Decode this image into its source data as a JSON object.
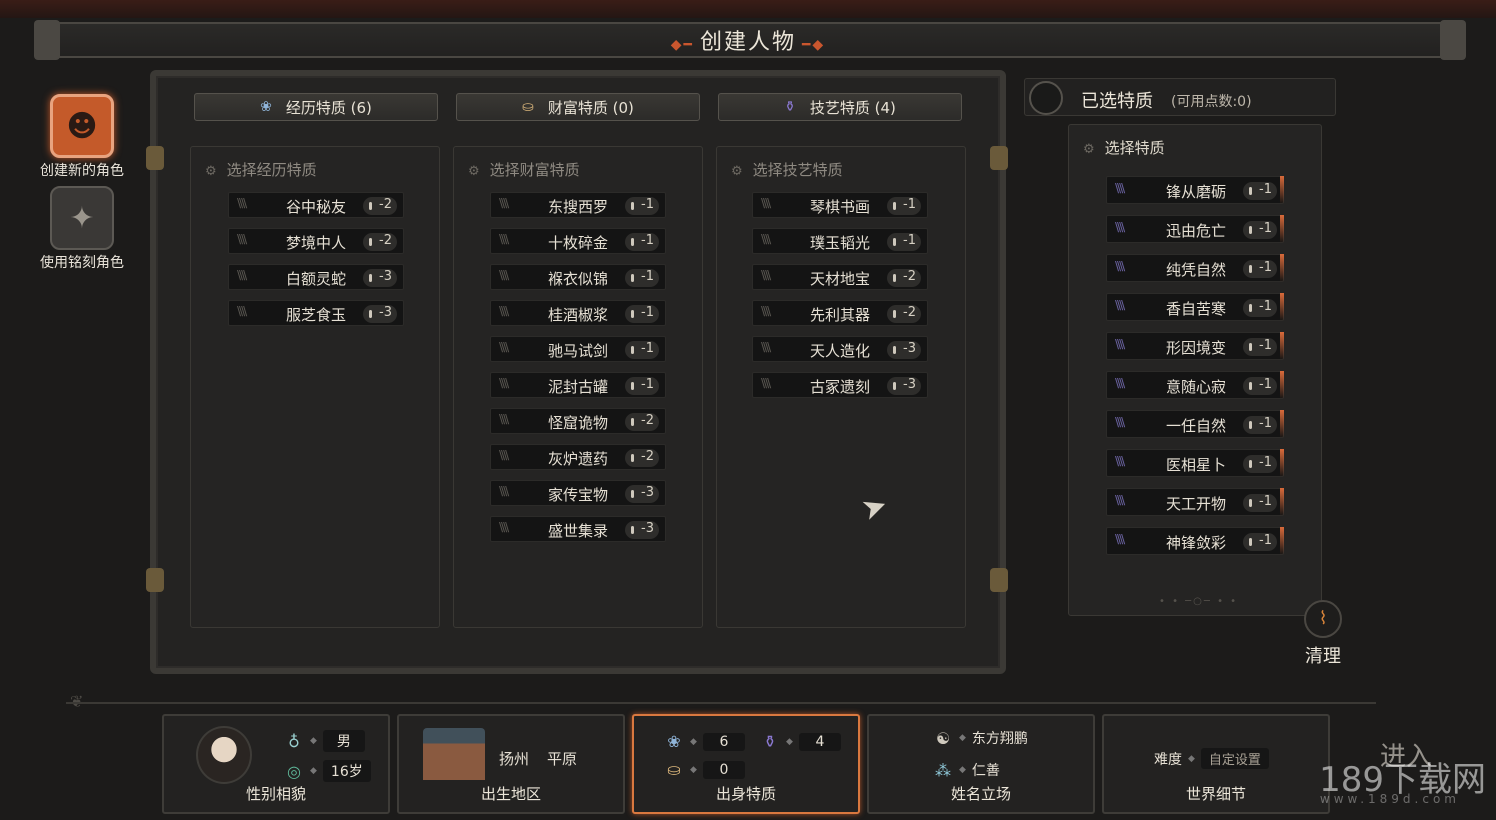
{
  "title": "创建人物",
  "side": {
    "create_new": "创建新的角色",
    "use_engraved": "使用铭刻角色"
  },
  "tabs": [
    {
      "label": "经历特质 (6)",
      "icon": "lotus-icon"
    },
    {
      "label": "财富特质 (0)",
      "icon": "ingot-icon"
    },
    {
      "label": "技艺特质 (4)",
      "icon": "vase-icon"
    }
  ],
  "columns": {
    "experience": {
      "header": "选择经历特质",
      "items": [
        {
          "name": "谷中秘友",
          "cost": "-2"
        },
        {
          "name": "梦境中人",
          "cost": "-2"
        },
        {
          "name": "白额灵蛇",
          "cost": "-3"
        },
        {
          "name": "服芝食玉",
          "cost": "-3"
        }
      ]
    },
    "wealth": {
      "header": "选择财富特质",
      "items": [
        {
          "name": "东搜西罗",
          "cost": "-1"
        },
        {
          "name": "十枚碎金",
          "cost": "-1"
        },
        {
          "name": "褓衣似锦",
          "cost": "-1"
        },
        {
          "name": "桂酒椒浆",
          "cost": "-1"
        },
        {
          "name": "驰马试剑",
          "cost": "-1"
        },
        {
          "name": "泥封古罐",
          "cost": "-1"
        },
        {
          "name": "怪窟诡物",
          "cost": "-2"
        },
        {
          "name": "灰炉遗药",
          "cost": "-2"
        },
        {
          "name": "家传宝物",
          "cost": "-3"
        },
        {
          "name": "盛世集录",
          "cost": "-3"
        }
      ]
    },
    "skill": {
      "header": "选择技艺特质",
      "items": [
        {
          "name": "琴棋书画",
          "cost": "-1"
        },
        {
          "name": "璞玉韬光",
          "cost": "-1"
        },
        {
          "name": "天材地宝",
          "cost": "-2"
        },
        {
          "name": "先利其器",
          "cost": "-2"
        },
        {
          "name": "天人造化",
          "cost": "-3"
        },
        {
          "name": "古冢遗刻",
          "cost": "-3"
        }
      ]
    }
  },
  "selected": {
    "title": "已选特质",
    "points": "(可用点数:0)",
    "header": "选择特质",
    "items": [
      {
        "name": "锋从磨砺",
        "cost": "-1"
      },
      {
        "name": "迅由危亡",
        "cost": "-1"
      },
      {
        "name": "纯凭自然",
        "cost": "-1"
      },
      {
        "name": "香自苦寒",
        "cost": "-1"
      },
      {
        "name": "形因境变",
        "cost": "-1"
      },
      {
        "name": "意随心寂",
        "cost": "-1"
      },
      {
        "name": "一任自然",
        "cost": "-1"
      },
      {
        "name": "医相星卜",
        "cost": "-1"
      },
      {
        "name": "天工开物",
        "cost": "-1"
      },
      {
        "name": "神锋敛彩",
        "cost": "-1"
      }
    ]
  },
  "clear_label": "清理",
  "bottom": {
    "gender": {
      "label": "性别相貌",
      "sex": "男",
      "age": "16岁"
    },
    "birthplace": {
      "label": "出生地区",
      "city": "扬州",
      "terrain": "平原"
    },
    "origin": {
      "label": "出身特质",
      "exp": "6",
      "skill": "4",
      "wealth": "0"
    },
    "name": {
      "label": "姓名立场",
      "fullname": "东方翔鹏",
      "stance": "仁善"
    },
    "world": {
      "label": "世界细节",
      "difficulty": "难度",
      "setting": "自定设置"
    }
  },
  "enter_label": "进入",
  "watermark": "189下载网",
  "watermark_url": "www.189d.com",
  "colors": {
    "accent": "#d9783f",
    "active_icon": "#c45a2a"
  }
}
